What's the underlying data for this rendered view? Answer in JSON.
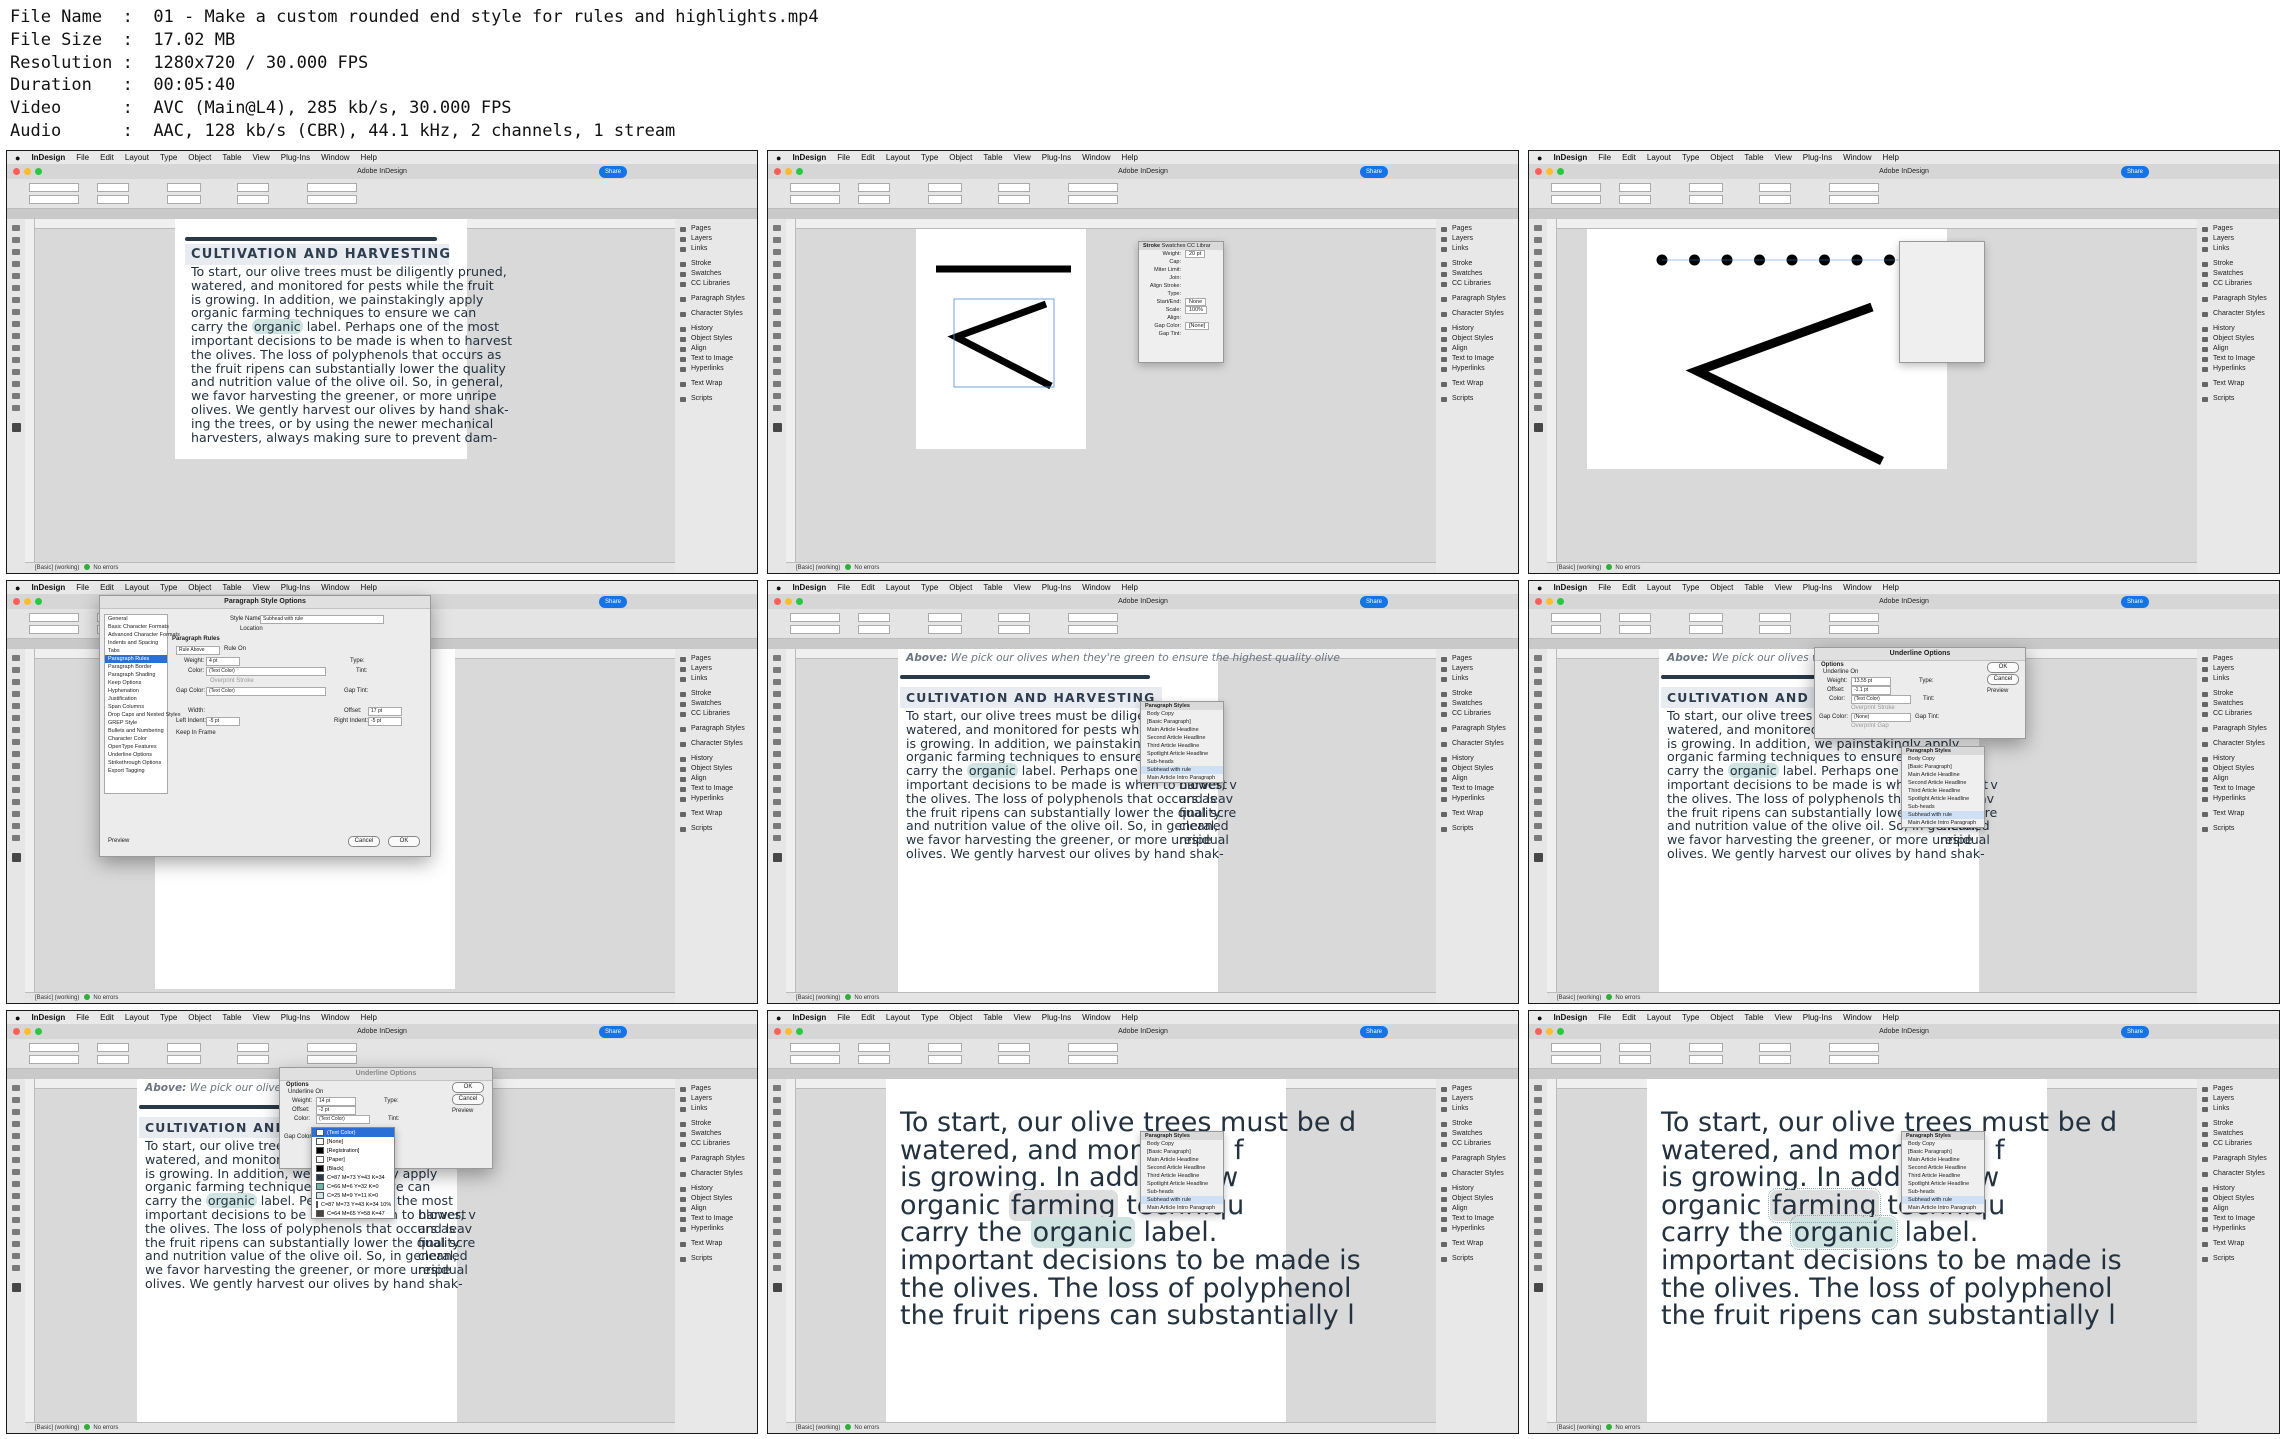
{
  "file_info": [
    {
      "label": "File Name",
      "value": "01 - Make a custom rounded end style for rules and highlights.mp4"
    },
    {
      "label": "File Size",
      "value": "17.02 MB"
    },
    {
      "label": "Resolution",
      "value": "1280x720 / 30.000 FPS"
    },
    {
      "label": "Duration",
      "value": "00:05:40"
    },
    {
      "label": "Video",
      "value": "AVC (Main@L4), 285 kb/s, 30.000 FPS"
    },
    {
      "label": "Audio",
      "value": "AAC, 128 kb/s (CBR), 44.1 kHz, 2 channels, 1 stream"
    }
  ],
  "app": {
    "name": "InDesign",
    "window_title": "Adobe InDesign",
    "share_label": "Share",
    "menu": [
      "File",
      "Edit",
      "Layout",
      "Type",
      "Object",
      "Table",
      "View",
      "Plug-Ins",
      "Window",
      "Help"
    ],
    "status_errors": "No errors",
    "status_style": "[Basic] (working)"
  },
  "panels": [
    "Pages",
    "Layers",
    "Links",
    "Stroke",
    "Swatches",
    "CC Libraries",
    "Paragraph Styles",
    "Character Styles",
    "History",
    "Object Styles",
    "Align",
    "Text to Image",
    "Hyperlinks",
    "Text Wrap",
    "Scripts"
  ],
  "document": {
    "heading": "CULTIVATION AND HARVESTING",
    "heading_partial": "CULTIVATION AND HAR",
    "caption_bold": "Above:",
    "caption_text": " We pick our olives when they're green to ensure the highest quality olive",
    "caption_text_short": " We pick our olives when th",
    "lines": [
      "To start, our olive trees must be diligently pruned,",
      "watered, and monitored for pests while the fruit",
      "is growing. In addition, we painstakingly apply",
      "organic farming techniques to ensure we can",
      "carry the",
      "organic",
      " label. Perhaps one of the most",
      "important decisions to be made is when to harvest",
      "the olives. The loss of polyphenols that occurs as",
      "the fruit ripens can substantially lower the quality",
      "and nutrition value of the olive oil. So, in general,",
      "we favor harvesting the greener, or more unripe",
      "olives. We gently harvest our olives by hand shak-",
      "ing the trees, or by using the newer mechanical",
      "harvesters, always making sure to prevent dam-"
    ],
    "side_col": [
      "blower, v",
      "and leav",
      "final scre",
      "cleaned",
      "residual"
    ],
    "zoom_lines": [
      "To start, our olive trees must be d",
      "watered, and monitored f",
      "is growing. In addition, w",
      "organic ",
      "farming",
      " techniqu",
      "carry the ",
      "organic",
      " label.",
      "important decisions to be made is",
      "the olives. The loss of polyphenol",
      "the fruit ripens can substantially l"
    ]
  },
  "paragraph_style_options": {
    "title": "Paragraph Style Options",
    "style_name_label": "Style Name:",
    "style_name": "Subhead with rule",
    "location_label": "Location",
    "section": "Paragraph Rules",
    "rule_above": "Rule Above",
    "rule_on": "Rule On",
    "weight_label": "Weight:",
    "weight": "4 pt",
    "type_label": "Type:",
    "color_label": "Color:",
    "color": "(Text Color)",
    "tint_label": "Tint:",
    "overprint": "Overprint Stroke",
    "gap_color_label": "Gap Color:",
    "gap_color": "(Text Color)",
    "gap_tint_label": "Gap Tint:",
    "width_label": "Width:",
    "offset_label": "Offset:",
    "offset": "17 pt",
    "left_indent_label": "Left Indent:",
    "left_indent": "-5 pt",
    "right_indent_label": "Right Indent:",
    "right_indent": "-5 pt",
    "keep_in_frame": "Keep In Frame",
    "preview": "Preview",
    "cancel": "Cancel",
    "ok": "OK",
    "categories": [
      "General",
      "Basic Character Formats",
      "Advanced Character Formats",
      "Indents and Spacing",
      "Tabs",
      "Paragraph Rules",
      "Paragraph Border",
      "Paragraph Shading",
      "Keep Options",
      "Hyphenation",
      "Justification",
      "Span Columns",
      "Drop Caps and Nested Styles",
      "GREP Style",
      "Bullets and Numbering",
      "Character Color",
      "OpenType Features",
      "Underline Options",
      "Strikethrough Options",
      "Export Tagging"
    ]
  },
  "underline_options": {
    "title": "Underline Options",
    "options_label": "Options",
    "underline_on": "Underline On",
    "weight_label": "Weight:",
    "weight": "13.55 pt",
    "weight_alt": "14 pt",
    "offset_label": "Offset:",
    "offset": "-1.1 pt",
    "offset_alt": "-2 pt",
    "type_label": "Type:",
    "color_label": "Color:",
    "color": "(Text Color)",
    "tint_label": "Tint:",
    "overprint": "Overprint Stroke",
    "gap_color_label": "Gap Color:",
    "gap_color": "(None)",
    "gap_tint_label": "Gap Tint:",
    "overprint_gap": "Overprint Gap",
    "ok": "OK",
    "cancel": "Cancel",
    "preview": "Preview",
    "swatch_list": [
      "(Text Color)",
      "[None]",
      "[Registration]",
      "[Paper]",
      "[Black]",
      "C=87 M=73 Y=43 K=34",
      "C=66 M=6 Y=32 K=0",
      "C=25 M=9 Y=11 K=0",
      "C=87 M=73 Y=43 K=34 10%",
      "C=64 M=65 Y=58 K=47"
    ]
  },
  "paragraph_styles_panel": {
    "title": "Paragraph Styles",
    "items": [
      "Body Copy",
      "[Basic Paragraph]",
      "Main Article Headline",
      "Second Article Headline",
      "Third Article Headline",
      "Spotlight Article Headline",
      "Sub-heads",
      "Subhead with rule",
      "Main Article Intro Paragraph"
    ]
  },
  "stroke_panel": {
    "tabs": [
      "Stroke",
      "Swatches",
      "CC Librar"
    ],
    "weight_label": "Weight:",
    "weight": "20 pt",
    "cap_label": "Cap:",
    "miter_label": "Miter Limit:",
    "join_label": "Join:",
    "align_label": "Align Stroke:",
    "type_label": "Type:",
    "start_end_label": "Start/End:",
    "start_value": "None",
    "scale_label": "Scale:",
    "scale": "100%",
    "align2_label": "Align:",
    "gap_color_label": "Gap Color:",
    "gap_color": "[None]",
    "gap_tint_label": "Gap Tint:"
  },
  "colors": {
    "heading": "#2e3e4f",
    "body": "#243240",
    "highlight": "#cfe3e1",
    "rule": "#2a3947",
    "share": "#1473e6"
  }
}
